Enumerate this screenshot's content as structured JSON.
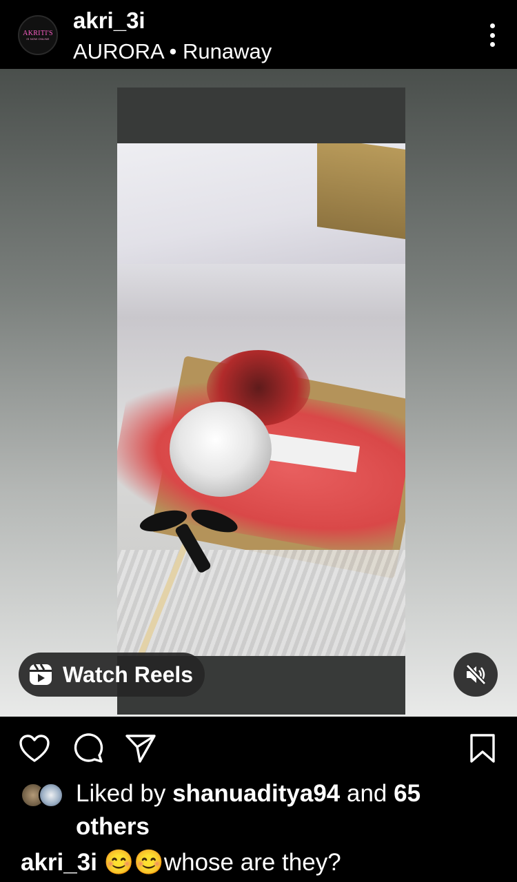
{
  "header": {
    "avatar_text_main": "AKRITI'S",
    "avatar_text_sub": "IS NOW ONLINE",
    "username": "akri_3i",
    "audio": "AURORA • Runaway"
  },
  "media": {
    "watch_reels_label": "Watch Reels"
  },
  "likes": {
    "prefix": "Liked by ",
    "user": "shanuaditya94",
    "middle": " and ",
    "count": "65",
    "suffix": " others"
  },
  "caption": {
    "username": "akri_3i",
    "emojis": "😊😊",
    "text": "whose are they?"
  },
  "icons": {
    "more": "more-vertical-icon",
    "reels": "reels-icon",
    "mute": "sound-off-icon",
    "like": "heart-icon",
    "comment": "comment-icon",
    "share": "send-icon",
    "save": "bookmark-icon"
  },
  "colors": {
    "background": "#000000",
    "text": "#ffffff",
    "avatar_accent": "#ff5fc8",
    "overlay_button": "#262626"
  }
}
